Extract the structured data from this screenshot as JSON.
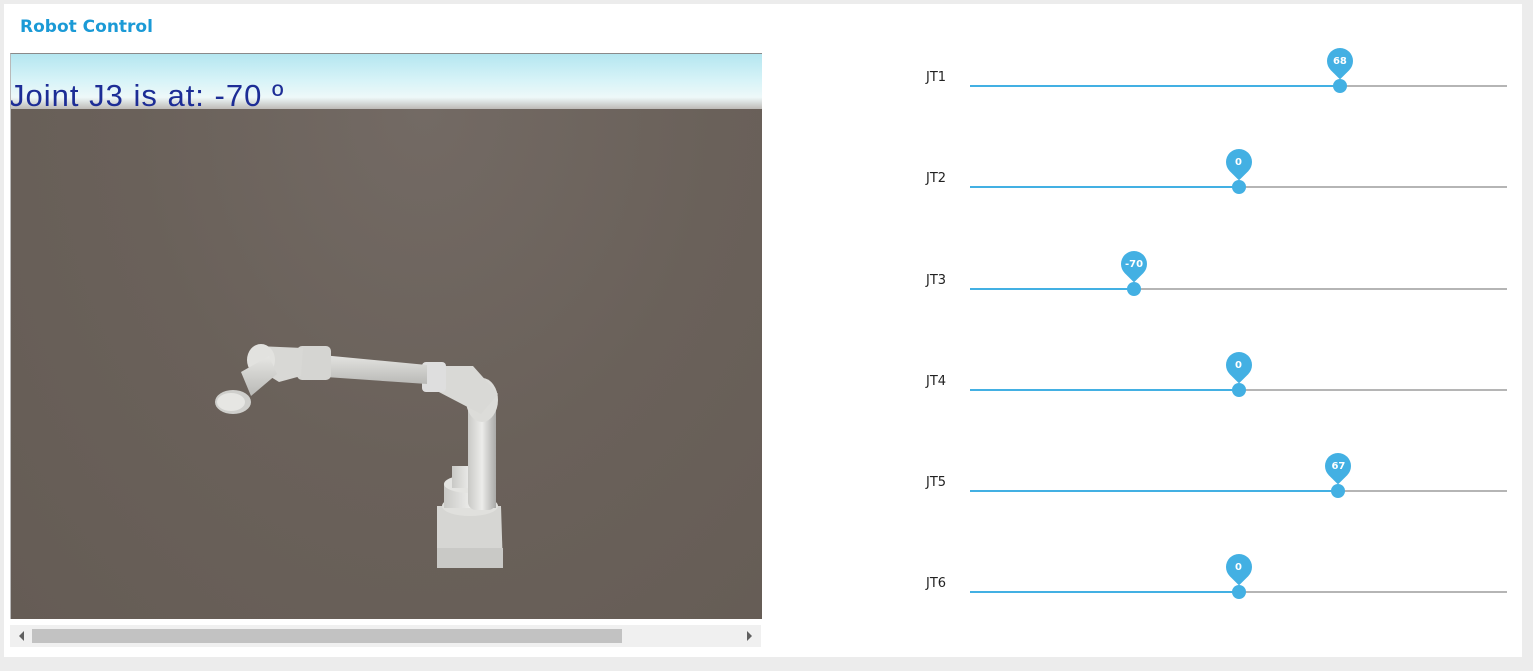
{
  "app": {
    "title": "Robot Control"
  },
  "viewport": {
    "overlay_text": "Joint J3 is at: -70 º",
    "scrollbar": {
      "position": 0.0
    }
  },
  "joints": [
    {
      "label": "JT1",
      "value": "68",
      "min": -180,
      "max": 180,
      "numeric": 68
    },
    {
      "label": "JT2",
      "value": "0",
      "min": -180,
      "max": 180,
      "numeric": 0
    },
    {
      "label": "JT3",
      "value": "-70",
      "min": -180,
      "max": 180,
      "numeric": -70
    },
    {
      "label": "JT4",
      "value": "0",
      "min": -180,
      "max": 180,
      "numeric": 0
    },
    {
      "label": "JT5",
      "value": "67",
      "min": -180,
      "max": 180,
      "numeric": 67
    },
    {
      "label": "JT6",
      "value": "0",
      "min": -180,
      "max": 180,
      "numeric": 0
    }
  ],
  "colors": {
    "accent": "#43b0e3",
    "title": "#1b9ad6",
    "overlay_text": "#1d2d96",
    "ground": "#686058"
  }
}
